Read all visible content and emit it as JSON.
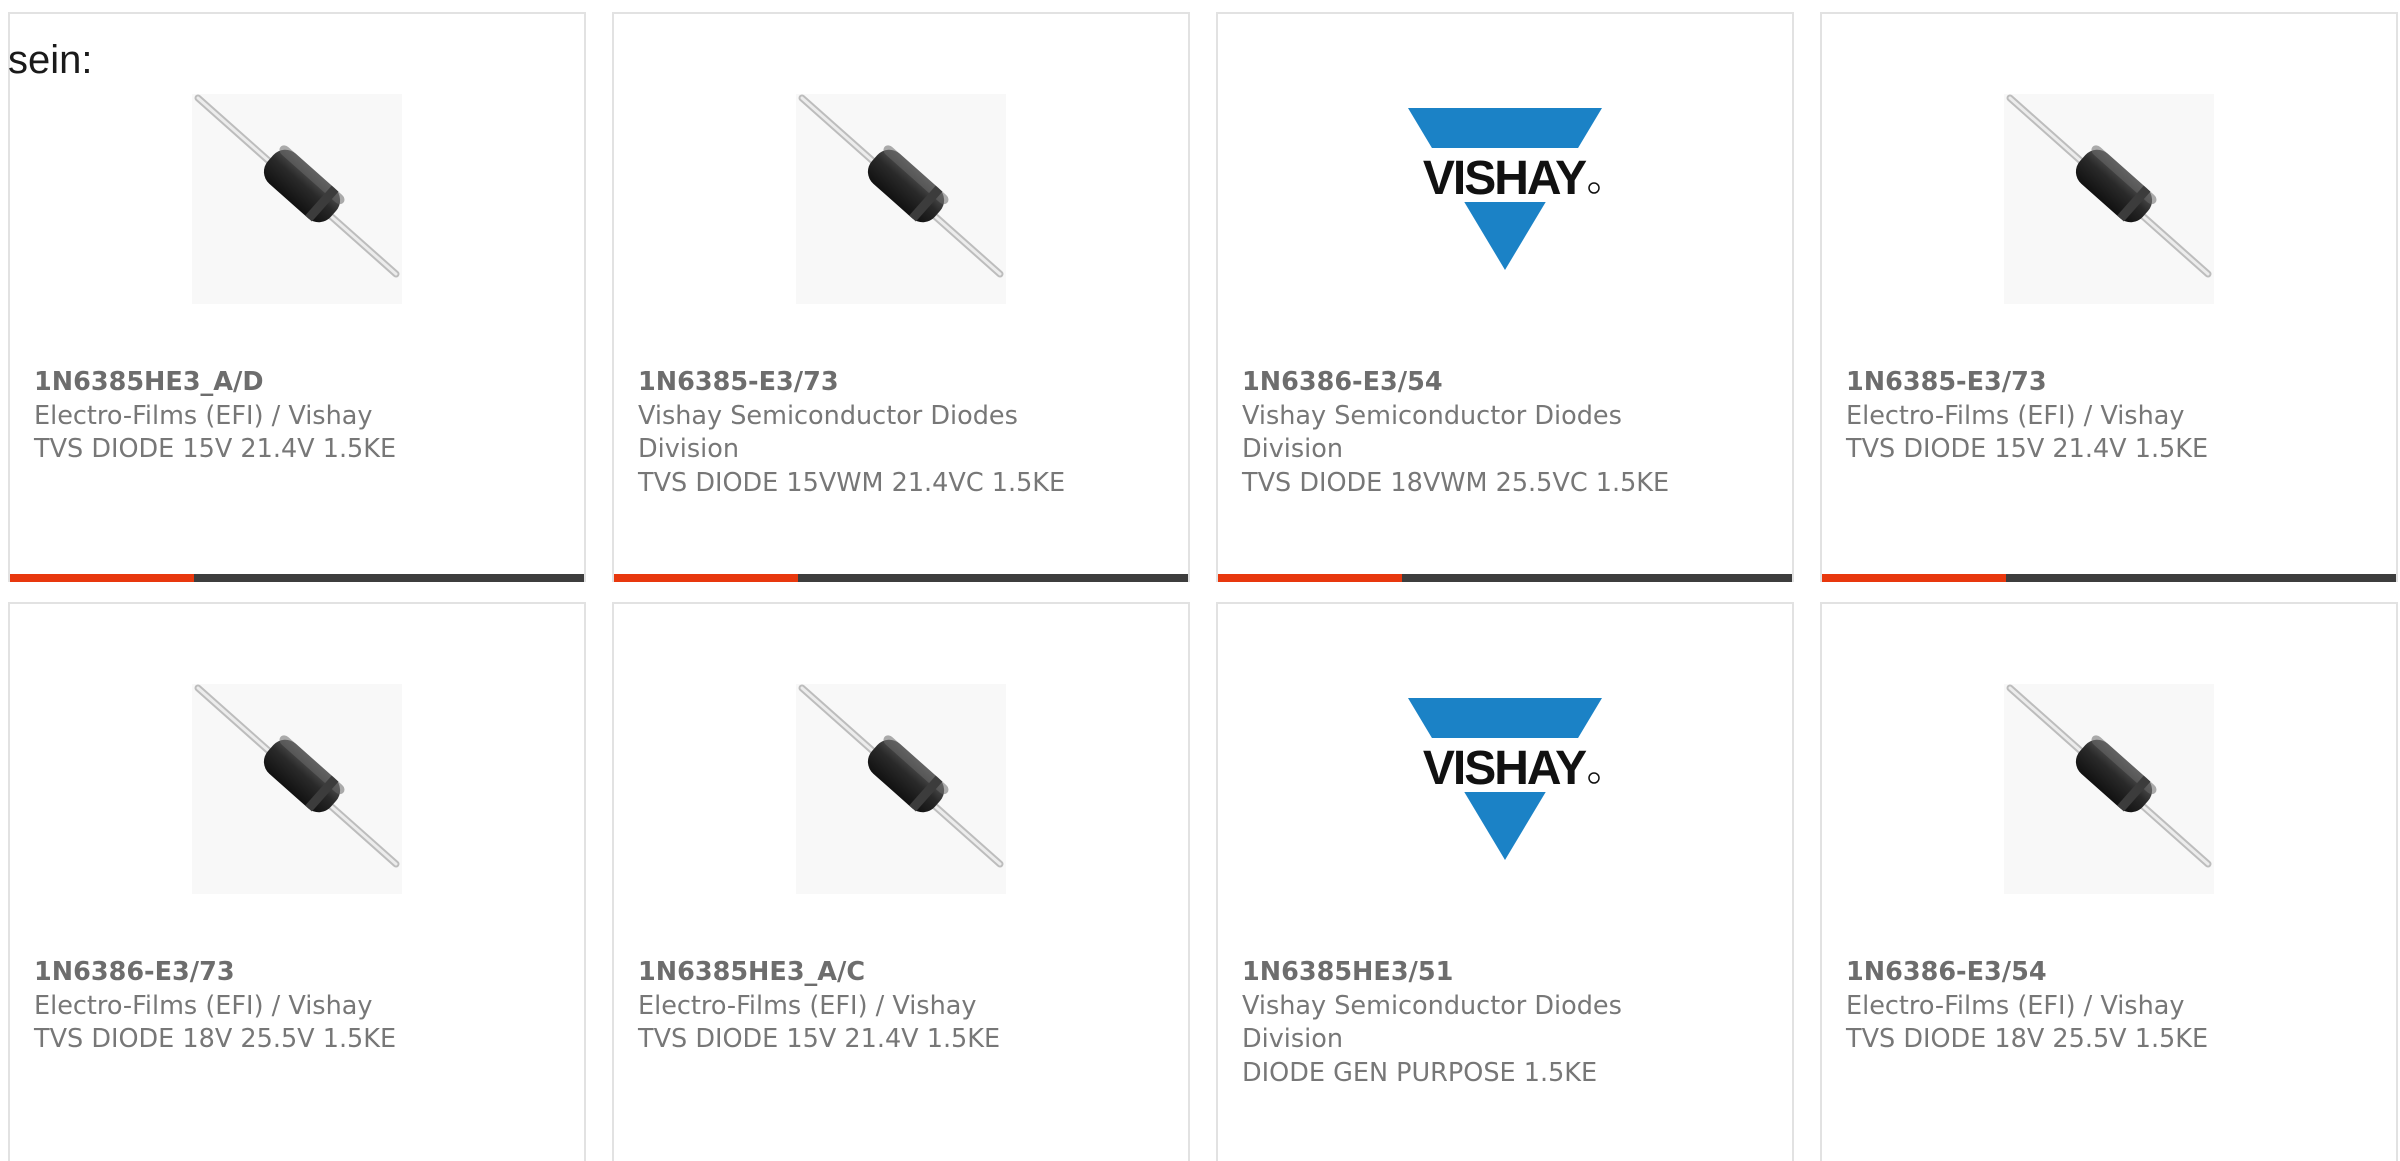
{
  "header": {
    "prefix_text": "sein:"
  },
  "colors": {
    "progress_fill": "#e8380e",
    "progress_track": "#3d3d3d",
    "vishay_blue": "#1b82c6",
    "vishay_text": "#111111",
    "card_border": "#e2e2e2",
    "text_muted": "#777777"
  },
  "products": [
    {
      "part_number": "1N6385HE3_A/D",
      "manufacturer": "Electro-Films (EFI) / Vishay",
      "description": "TVS DIODE 15V 21.4V 1.5KE",
      "image": "diode-image",
      "progress": 0.32
    },
    {
      "part_number": "1N6385-E3/73",
      "manufacturer": "Vishay Semiconductor Diodes Division",
      "description": "TVS DIODE 15VWM 21.4VC 1.5KE",
      "image": "diode-image",
      "progress": 0.32
    },
    {
      "part_number": "1N6386-E3/54",
      "manufacturer": "Vishay Semiconductor Diodes Division",
      "description": "TVS DIODE 18VWM 25.5VC 1.5KE",
      "image": "vishay-logo",
      "logo_text": "VISHAY",
      "progress": 0.32
    },
    {
      "part_number": "1N6385-E3/73",
      "manufacturer": "Electro-Films (EFI) / Vishay",
      "description": "TVS DIODE 15V 21.4V 1.5KE",
      "image": "diode-image",
      "progress": 0.32
    },
    {
      "part_number": "1N6386-E3/73",
      "manufacturer": "Electro-Films (EFI) / Vishay",
      "description": "TVS DIODE 18V 25.5V 1.5KE",
      "image": "diode-image"
    },
    {
      "part_number": "1N6385HE3_A/C",
      "manufacturer": "Electro-Films (EFI) / Vishay",
      "description": "TVS DIODE 15V 21.4V 1.5KE",
      "image": "diode-image"
    },
    {
      "part_number": "1N6385HE3/51",
      "manufacturer": "Vishay Semiconductor Diodes Division",
      "description": "DIODE GEN PURPOSE 1.5KE",
      "image": "vishay-logo",
      "logo_text": "VISHAY"
    },
    {
      "part_number": "1N6386-E3/54",
      "manufacturer": "Electro-Films (EFI) / Vishay",
      "description": "TVS DIODE 18V 25.5V 1.5KE",
      "image": "diode-image"
    }
  ]
}
